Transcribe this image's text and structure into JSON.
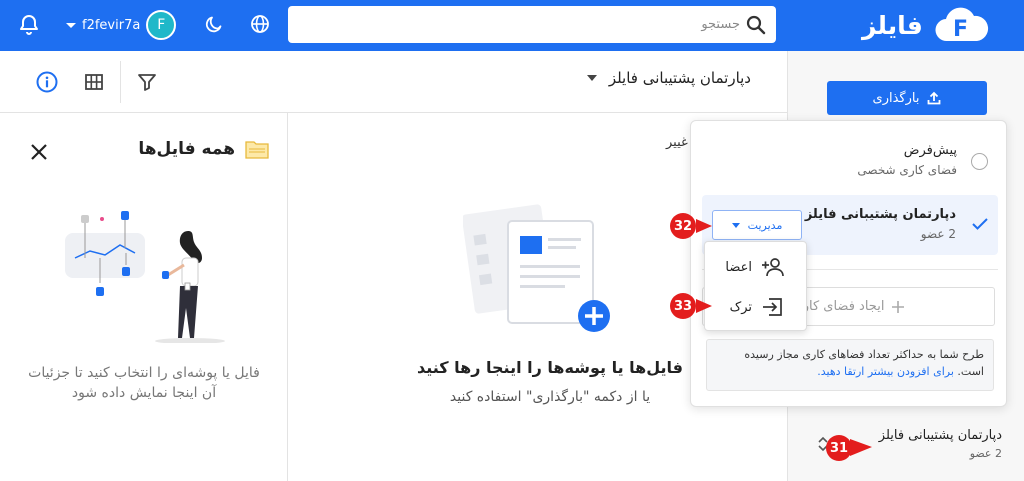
{
  "header": {
    "logo_text": "فایلز",
    "username": "f2fevir7a",
    "avatar_letter": "F",
    "search_placeholder": "جستجو",
    "brand_color": "#1e6ff1"
  },
  "toolbar": {
    "workspace_title": "دپارتمان پشتیبانی فایلز"
  },
  "details": {
    "title": "همه فایل‌ها",
    "hint": "فایل یا پوشه‌ای را انتخاب کنید تا جزئیات آن اینجا نمایش داده شود"
  },
  "dropzone": {
    "partial_label": "غییر",
    "title": "فایل‌ها یا پوشه‌ها را اینجا رها کنید",
    "subtitle": "یا از دکمه \"بارگذاری\" استفاده کنید"
  },
  "sidebar": {
    "upload_label": "بارگذاری",
    "current_workspace": {
      "name": "دپارتمان پشتیبانی فایلز",
      "members": "2 عضو"
    }
  },
  "popup": {
    "workspaces": [
      {
        "name": "پیش‌فرض",
        "subtitle": "فضای کاری شخصی"
      },
      {
        "name": "دپارتمان پشتیبانی فایلز",
        "subtitle": "2 عضو"
      }
    ],
    "manage_label": "مدیریت",
    "create_label": "ایجاد فضای کاری",
    "notice_text": "طرح شما به حداکثر تعداد فضاهای کاری مجاز رسیده است.",
    "notice_link": "برای افزودن بیشتر ارتقا دهید."
  },
  "manage_menu": {
    "members_label": "اعضا",
    "leave_label": "ترک"
  },
  "markers": {
    "m31": "31",
    "m32": "32",
    "m33": "33"
  }
}
